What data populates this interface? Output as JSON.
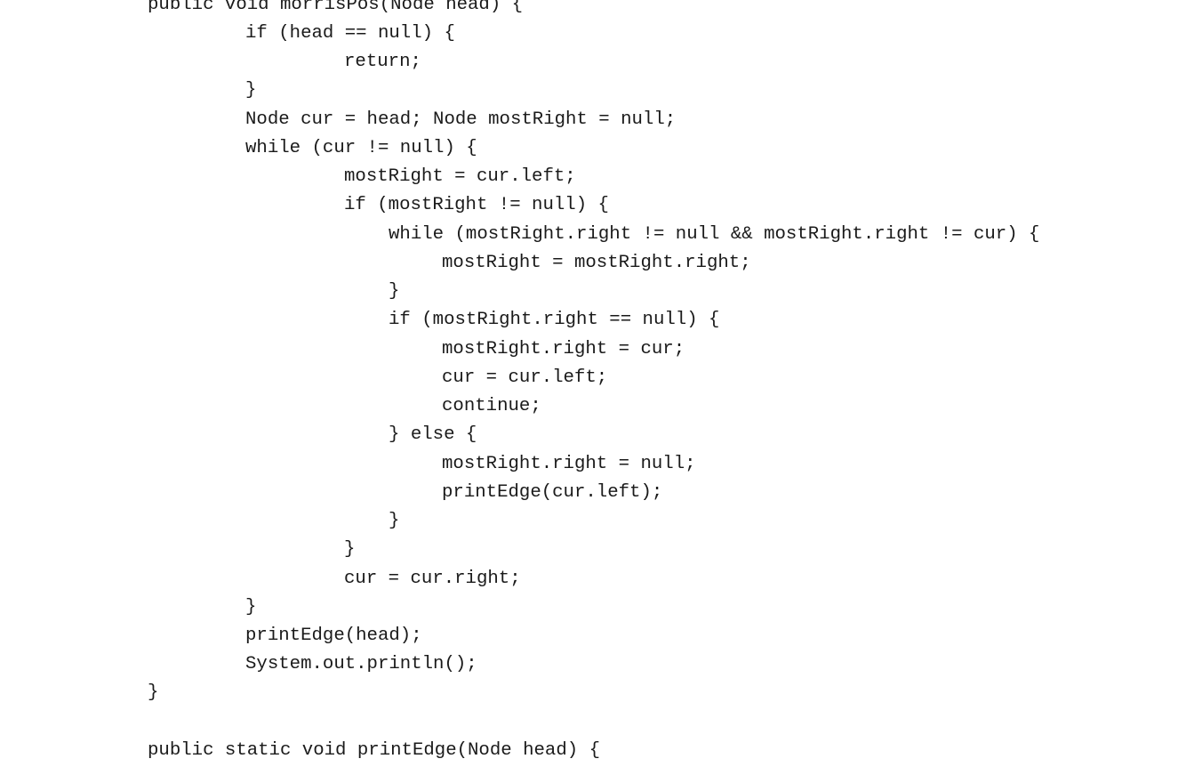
{
  "code": {
    "lines": [
      "public void morrisPos(Node head) {",
      "if (head == null) {",
      "return;",
      "}",
      "Node cur = head; Node mostRight = null;",
      "while (cur != null) {",
      "mostRight = cur.left;",
      "if (mostRight != null) {",
      "while (mostRight.right != null && mostRight.right != cur) {",
      "mostRight = mostRight.right;",
      "}",
      "if (mostRight.right == null) {",
      "mostRight.right = cur;",
      "cur = cur.left;",
      "continue;",
      "} else {",
      "mostRight.right = null;",
      "printEdge(cur.left);",
      "}",
      "}",
      "cur = cur.right;",
      "}",
      "printEdge(head);",
      "System.out.println();",
      "}",
      "public static void printEdge(Node head) {"
    ]
  }
}
